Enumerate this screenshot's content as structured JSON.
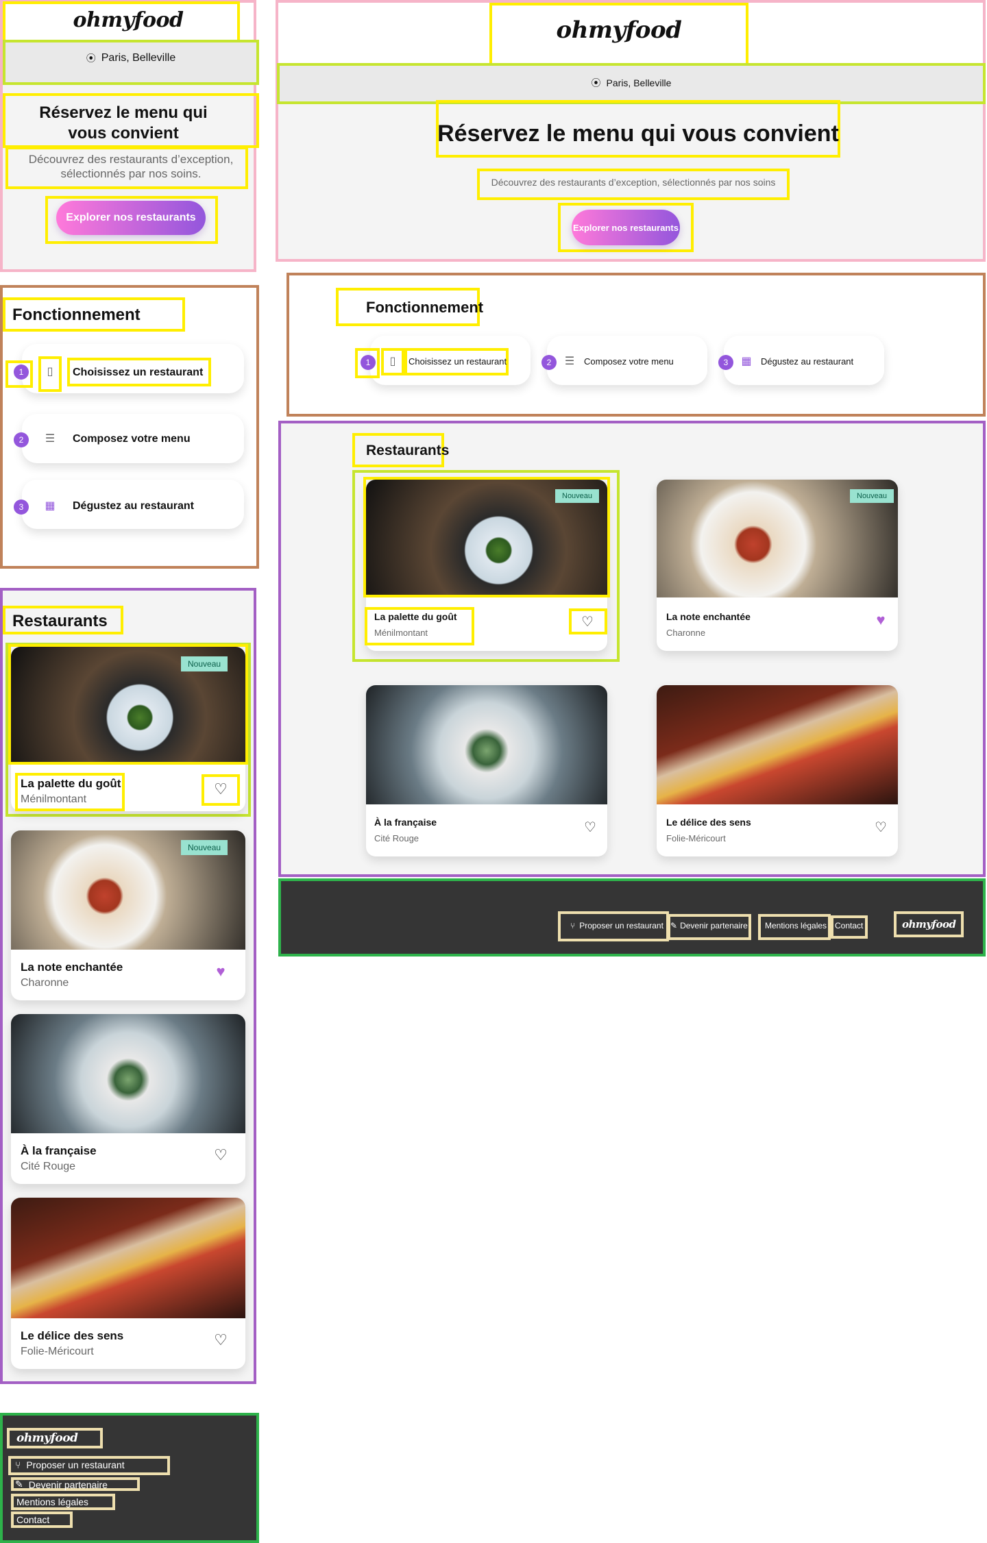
{
  "brand": {
    "logo": "ohmyfood"
  },
  "location": {
    "icon": "map-pin-icon",
    "text": "Paris, Belleville"
  },
  "hero": {
    "title": "Réservez le menu qui vous convient",
    "subtitle_mobile": "Découvrez des restaurants d’exception, sélectionnés par nos soins.",
    "subtitle_desktop": "Découvrez des restaurants d’exception, sélectionnés par nos soins",
    "cta": "Explorer nos restaurants"
  },
  "how": {
    "title": "Fonctionnement",
    "steps": [
      {
        "number": "1",
        "icon": "phone-icon",
        "label": "Choisissez un restaurant"
      },
      {
        "number": "2",
        "icon": "list-icon",
        "label": "Composez votre menu"
      },
      {
        "number": "3",
        "icon": "store-icon",
        "label": "Dégustez au restaurant"
      }
    ]
  },
  "restaurants": {
    "title": "Restaurants",
    "items": [
      {
        "name": "La palette du goût",
        "area_mobile": "Ménilmontant",
        "area_desktop": "Ménilmontant",
        "badge": "Nouveau",
        "liked": false
      },
      {
        "name": "La note enchantée",
        "area_mobile": "Charonne",
        "area_desktop": "Charonne",
        "badge": "Nouveau",
        "liked": true
      },
      {
        "name": "À la française",
        "area_mobile": "Cité Rouge",
        "area_desktop": "Cité Rouge",
        "badge": "",
        "liked": false
      },
      {
        "name": "Le délice des sens",
        "area_mobile": "Folie-Méricourt",
        "area_desktop": "Folie-Méricourt",
        "badge": "",
        "liked": false
      }
    ]
  },
  "footer": {
    "logo": "ohmyfood",
    "links": [
      {
        "icon": "utensils-icon",
        "label": "Proposer un restaurant"
      },
      {
        "icon": "handshake-icon",
        "label": "Devenir partenaire"
      },
      {
        "icon": "",
        "label": "Mentions légales"
      },
      {
        "icon": "",
        "label": "Contact"
      }
    ]
  },
  "colors": {
    "accent_start": "#ff79da",
    "accent_end": "#9356dc",
    "badge_bg": "#99e2d0",
    "footer_bg": "#353535"
  }
}
